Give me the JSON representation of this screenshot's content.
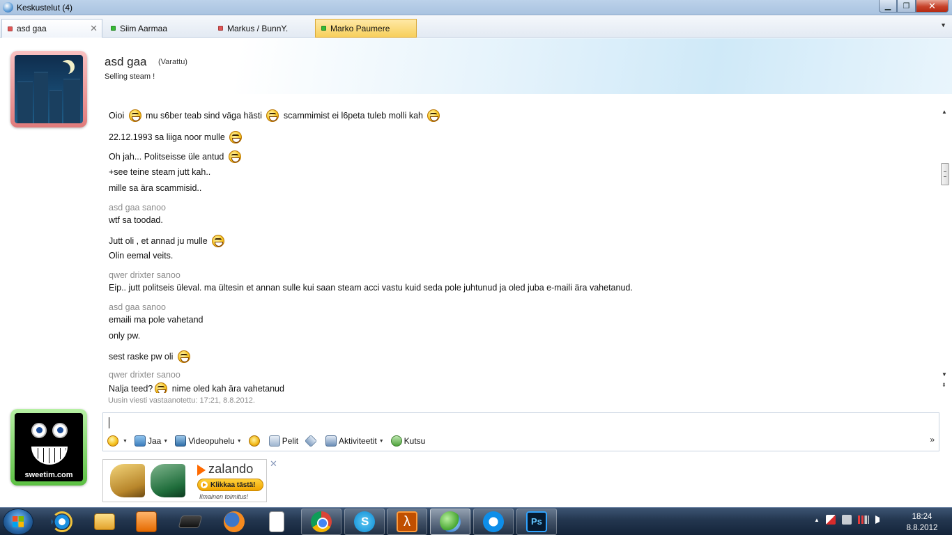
{
  "window": {
    "title": "Keskustelut (4)",
    "minimize": "▁",
    "maximize": "❐",
    "close": "✕"
  },
  "tabs": [
    {
      "label": "asd gaa",
      "status_color": "#e05555",
      "close": "✕"
    },
    {
      "label": "Siim Aarmaa",
      "status_color": "#35b935"
    },
    {
      "label": "Markus / BunnY.",
      "status_color": "#e05555"
    },
    {
      "label": "Marko Paumere",
      "status_color": "#35b935"
    }
  ],
  "tabs_menu": "▼",
  "contact": {
    "name": "asd gaa",
    "status": "(Varattu)",
    "personal_message": "Selling steam !"
  },
  "messages": [
    {
      "type": "text",
      "parts": [
        "Oioi ",
        ":emo",
        " mu s6ber teab sind väga hästi ",
        ":emo",
        " scammimist ei l6peta tuleb molli kah ",
        ":emo"
      ]
    },
    {
      "type": "text",
      "parts": [
        "22.12.1993 sa liiga noor mulle ",
        ":emo"
      ]
    },
    {
      "type": "text",
      "parts": [
        "Oh jah... Politseisse üle antud ",
        ":emo"
      ]
    },
    {
      "type": "text",
      "parts": [
        "+see teine steam jutt kah.."
      ]
    },
    {
      "type": "text",
      "parts": [
        "mille sa ära scammisid.."
      ]
    },
    {
      "type": "sender",
      "parts": [
        "asd gaa sanoo"
      ]
    },
    {
      "type": "text",
      "parts": [
        "wtf sa toodad."
      ]
    },
    {
      "type": "text",
      "parts": [
        "Jutt oli , et annad ju mulle ",
        ":emo"
      ]
    },
    {
      "type": "text",
      "parts": [
        "Olin eemal veits."
      ]
    },
    {
      "type": "sender",
      "parts": [
        "qwer drixter sanoo"
      ]
    },
    {
      "type": "text",
      "parts": [
        "Eip.. jutt politseis üleval. ma ültesin et annan sulle kui saan steam acci vastu kuid seda pole juhtunud ja oled juba e-maili ära vahetanud."
      ]
    },
    {
      "type": "sender",
      "parts": [
        "asd gaa sanoo"
      ]
    },
    {
      "type": "text",
      "parts": [
        "emaili ma pole vahetand"
      ]
    },
    {
      "type": "text",
      "parts": [
        "only pw."
      ]
    },
    {
      "type": "text",
      "parts": [
        "sest raske pw oli ",
        ":emo"
      ]
    },
    {
      "type": "sender",
      "parts": [
        "qwer drixter sanoo"
      ]
    },
    {
      "type": "text",
      "parts": [
        "Nalja teed?",
        ":emo",
        " nime oled kah ära vahetanud"
      ]
    }
  ],
  "last_received": "Uusin viesti vastaanotettu: 17:21, 8.8.2012.",
  "composer": {
    "value": "",
    "toolbar": [
      {
        "icon": "smiley-icon",
        "label": "",
        "dropdown": true
      },
      {
        "icon": "share-icon",
        "label": "Jaa",
        "dropdown": true
      },
      {
        "icon": "videocall-icon",
        "label": "Videopuhelu",
        "dropdown": true
      },
      {
        "icon": "wink-icon",
        "label": "",
        "dropdown": false
      },
      {
        "icon": "games-icon",
        "label": "Pelit",
        "dropdown": false
      },
      {
        "icon": "nudge-icon",
        "label": "",
        "dropdown": false
      },
      {
        "icon": "activities-icon",
        "label": "Aktiviteetit",
        "dropdown": true
      },
      {
        "icon": "invite-icon",
        "label": "Kutsu",
        "dropdown": false
      }
    ],
    "more": "»"
  },
  "my_avatar": {
    "brand": "sweetim.com"
  },
  "ad": {
    "brand": "zalando",
    "cta": "Klikkaa tästä!",
    "subtitle": "Ilmainen toimitus!",
    "close": "✕"
  },
  "taskbar": {
    "apps": [
      "internet-explorer-icon",
      "folder-icon",
      "media-player-icon",
      "laptop-icon",
      "firefox-icon",
      "document-icon",
      "chrome-icon",
      "skype-icon",
      "half-life-icon",
      "messenger-icon",
      "teamviewer-icon",
      "photoshop-icon"
    ],
    "tray_up": "▲",
    "time": "18:24",
    "date": "8.8.2012"
  }
}
